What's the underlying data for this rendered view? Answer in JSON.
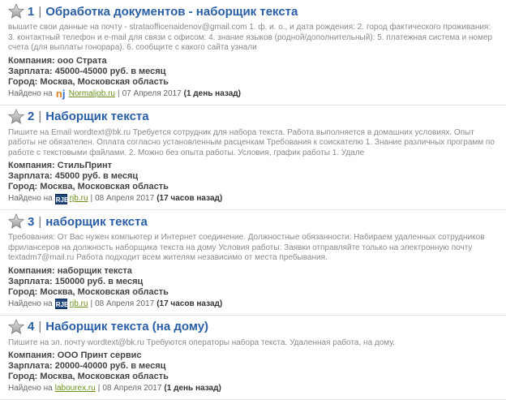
{
  "jobs": [
    {
      "num": "1",
      "sep": "|",
      "title": "Обработка документов - наборщик текста",
      "description": "вышите свои данные на почту - strataofficenaidenov@gmail.com 1. ф. и. о., и дата рождения: 2. город фактического проживания: 3. контактный телефон и e-mail для связи с офисом: 4. знание языков (родной/дополнительный): 5. платежная система и номер счета (для выплаты гонорара). 6. сообщите с какого сайта узнали",
      "company": "Компания: ооо Страта",
      "salary": "Зарплата: 45000-45000 руб. в месяц",
      "city": "Город: Москва, Московская область",
      "found_prefix": "Найдено на",
      "logo": "nj",
      "source": "Normaljob.ru",
      "date": "07 Апреля 2017",
      "ago": "(1 день назад)"
    },
    {
      "num": "2",
      "sep": "|",
      "title": "Наборщик текста",
      "description": "Пишите на Email wordtext@bk.ru Требуется сотрудник для набора текста. Работа выполняется в домашних условиях. Опыт работы не обязателен. Оплата согласно установленным расценкам Требования к соискателю 1. Знание различных программ по работе с текстовыми файлами. 2. Можно без опыта работы. Условия, график работы 1. Удале",
      "company": "Компания: СтильПринт",
      "salary": "Зарплата: 45000 руб. в месяц",
      "city": "Город: Москва, Московская область",
      "found_prefix": "Найдено на",
      "logo": "rjb",
      "source": "rjb.ru",
      "date": "08 Апреля 2017",
      "ago": "(17 часов назад)"
    },
    {
      "num": "3",
      "sep": "|",
      "title": "наборщик текста",
      "description": "Требования: От Вас нужен компьютер и Интернет соединение. Должностные обязанности: Набираем удаленных сотрудников фрилансеров на должность наборщика текста на дому Условия работы: Заявки отправляйте только на электронную почту textadm7@mail.ru Работа подходит всем жителям независимо от места пребывания.",
      "company": "Компания: наборщик текста",
      "salary": "Зарплата: 150000 руб. в месяц",
      "city": "Город: Москва, Московская область",
      "found_prefix": "Найдено на",
      "logo": "rjb",
      "source": "rjb.ru",
      "date": "08 Апреля 2017",
      "ago": "(17 часов назад)"
    },
    {
      "num": "4",
      "sep": "|",
      "title": "Наборщик текста (на дому)",
      "description": "Пишите на эл. почту wordtext@bk.ru Требуются операторы набора текста. Удаленная работа, на дому.",
      "company": "Компания: ООО Принт сервис",
      "salary": "Зарплата: 20000-40000 руб. в месяц",
      "city": "Город: Москва, Московская область",
      "found_prefix": "Найдено на",
      "logo": "",
      "source": "labourex.ru",
      "date": "08 Апреля 2017",
      "ago": "(1 день назад)"
    }
  ],
  "logo_text": {
    "nj": "nj",
    "rjb": "RJB"
  },
  "colors": {
    "title": "#2a5ea6",
    "link": "#6b8f1a",
    "description": "#8a8a8a"
  }
}
